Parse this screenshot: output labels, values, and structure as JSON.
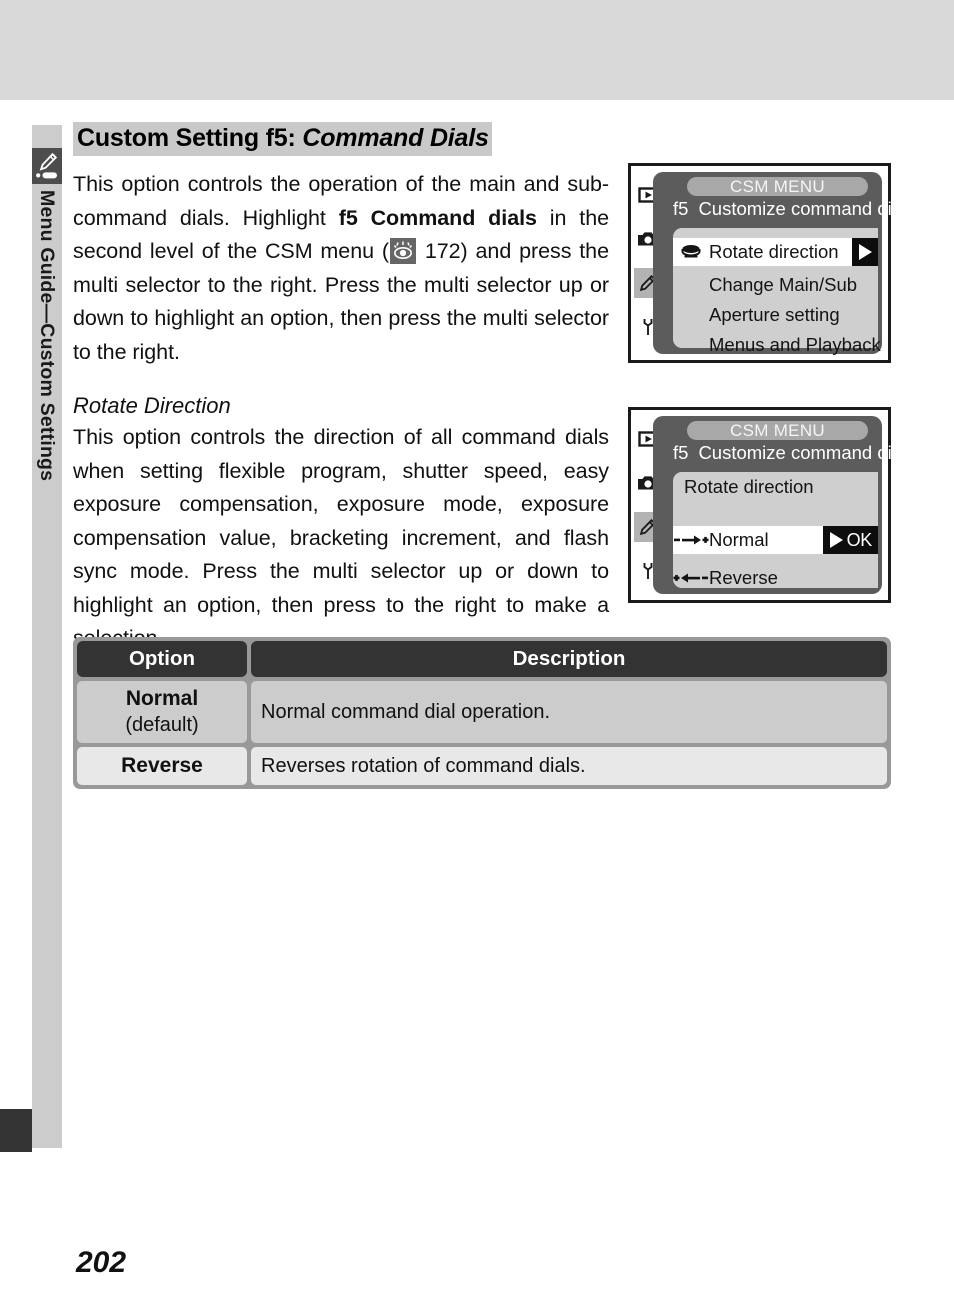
{
  "sidebar": {
    "icon": "pencil-icon",
    "vertical_label": "Menu Guide—Custom Settings"
  },
  "page": {
    "number": "202"
  },
  "heading": {
    "prefix": "Custom Setting f5: ",
    "emphasis": "Command Dials"
  },
  "body": {
    "para1_a": "This option controls the operation of the main and sub-command dials.  Highlight ",
    "para1_bold": "f5 Command dials",
    "para1_b": " in the second level of the CSM menu (",
    "para1_ref_icon": "eye-icon",
    "para1_c": " 172) and press the multi selector to the right. Press the multi selector up or down to highlight an option, then press the multi selector to the right.",
    "subheading": "Rotate Direction",
    "para2": "This option controls the direction of all command dials when setting flexible program, shutter speed, easy exposure compensation, exposure mode, exposure compensation value, bracketing increment, and flash sync mode.  Press the multi selector up or down to highlight an option, then press to the right to make a selection."
  },
  "lcd1": {
    "title": "CSM MENU",
    "setting_number": "f5",
    "subtitle": "Customize command dials",
    "tabs": [
      {
        "name": "playback-tab-icon",
        "active": false
      },
      {
        "name": "shooting-tab-icon",
        "active": false
      },
      {
        "name": "custom-settings-tab-icon",
        "active": true
      },
      {
        "name": "setup-tab-icon",
        "active": false
      }
    ],
    "items": [
      {
        "label": "Rotate direction",
        "icon": "command-dial-icon",
        "selected": true,
        "badge": "arrow-right"
      },
      {
        "label": "Change Main/Sub",
        "icon": "",
        "selected": false
      },
      {
        "label": "Aperture setting",
        "icon": "",
        "selected": false
      },
      {
        "label": "Menus and Playback",
        "icon": "",
        "selected": false
      }
    ]
  },
  "lcd2": {
    "title": "CSM MENU",
    "setting_number": "f5",
    "subtitle": "Customize command dials",
    "panel_heading": "Rotate direction",
    "tabs": [
      {
        "name": "playback-tab-icon",
        "active": false
      },
      {
        "name": "shooting-tab-icon",
        "active": false
      },
      {
        "name": "custom-settings-tab-icon",
        "active": true
      },
      {
        "name": "setup-tab-icon",
        "active": false
      }
    ],
    "items": [
      {
        "label": "Normal",
        "icon": "minus-arrow-right-plus-icon",
        "selected": true,
        "badge_text": "OK"
      },
      {
        "label": "Reverse",
        "icon": "plus-arrow-left-minus-icon",
        "selected": false
      }
    ]
  },
  "table": {
    "headers": [
      "Option",
      "Description"
    ],
    "rows": [
      {
        "option": "Normal",
        "option_sub": "(default)",
        "description": "Normal command dial operation."
      },
      {
        "option": "Reverse",
        "option_sub": "",
        "description": "Reverses rotation of command dials."
      }
    ]
  }
}
